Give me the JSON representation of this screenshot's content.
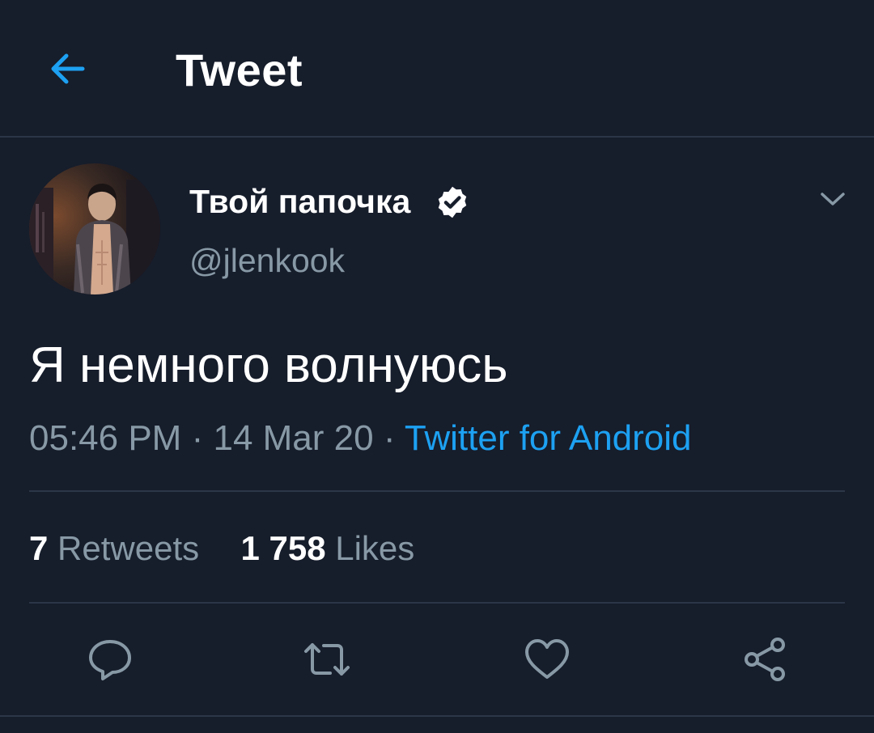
{
  "header": {
    "title": "Tweet",
    "back_icon": "arrow-left-icon"
  },
  "tweet": {
    "author": {
      "display_name": "Твой папочка",
      "handle": "@jlenkook",
      "verified": true
    },
    "text": "Я немного волнуюсь",
    "time": "05:46 PM",
    "date": "14 Mar 20",
    "separator": "·",
    "source": "Twitter for Android",
    "stats": {
      "retweets_count": "7",
      "retweets_label": "Retweets",
      "likes_count": "1 758",
      "likes_label": "Likes"
    }
  },
  "actions": [
    "reply-icon",
    "retweet-icon",
    "like-icon",
    "share-icon"
  ],
  "colors": {
    "background": "#161d2b",
    "accent": "#1da1f2",
    "muted_text": "#8899a6",
    "divider": "#2b3647"
  }
}
